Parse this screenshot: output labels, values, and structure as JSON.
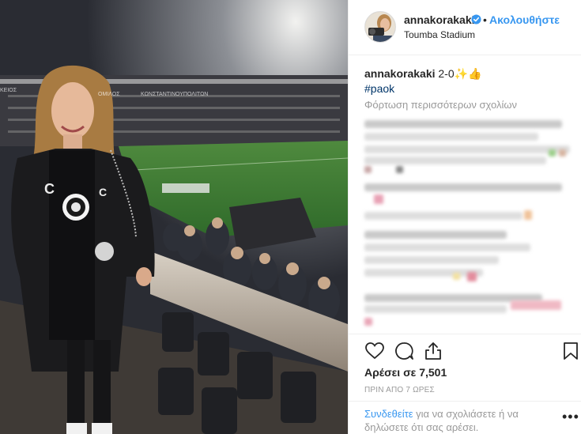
{
  "post": {
    "username": "annakorakaki",
    "follow_label": "Ακολουθήστε",
    "separator": "•",
    "location": "Toumba Stadium",
    "caption_user": "annakorakaki",
    "caption_text": "2-0✨👍",
    "hashtag": "#paok",
    "load_more": "Φόρτωση περισσότερων σχολίων",
    "likes_text": "Αρέσει σε 7,501",
    "timestamp": "ΠΡΙΝ ΑΠΟ 7 ΩΡΕΣ",
    "login_link": "Συνδεθείτε",
    "login_rest": " για να σχολιάσετε ή να δηλώσετε ότι σας αρέσει.",
    "more_icon_text": "•••"
  },
  "colors": {
    "link_blue": "#3897f0",
    "hashtag_blue": "#003569",
    "muted_gray": "#999999",
    "divider": "#efefef"
  },
  "icons": [
    "verified-badge-icon",
    "heart-icon",
    "comment-icon",
    "share-icon",
    "bookmark-icon",
    "more-options-icon"
  ]
}
